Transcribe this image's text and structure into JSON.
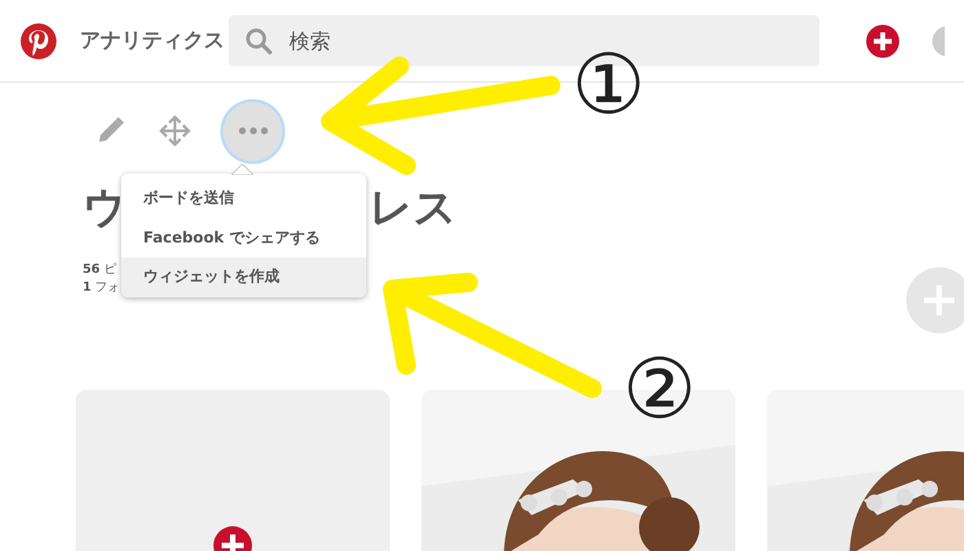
{
  "header": {
    "page_title": "アナリティクス",
    "search": {
      "placeholder": "検索"
    }
  },
  "board_menu": {
    "items": [
      {
        "label": "ボードを送信",
        "selected": false
      },
      {
        "label": "Facebook でシェアする",
        "selected": false
      },
      {
        "label": "ウィジェットを作成",
        "selected": true
      }
    ]
  },
  "board": {
    "title_parts": [
      "ウ",
      "レス"
    ],
    "stats": [
      {
        "count": "56",
        "label": "ピ"
      },
      {
        "count": "1",
        "label": "フォ"
      }
    ]
  },
  "pins": [
    {
      "kind": "add"
    },
    {
      "kind": "picture"
    },
    {
      "kind": "picture"
    }
  ],
  "annotations": [
    {
      "number": "①"
    },
    {
      "number": "②"
    }
  ]
}
